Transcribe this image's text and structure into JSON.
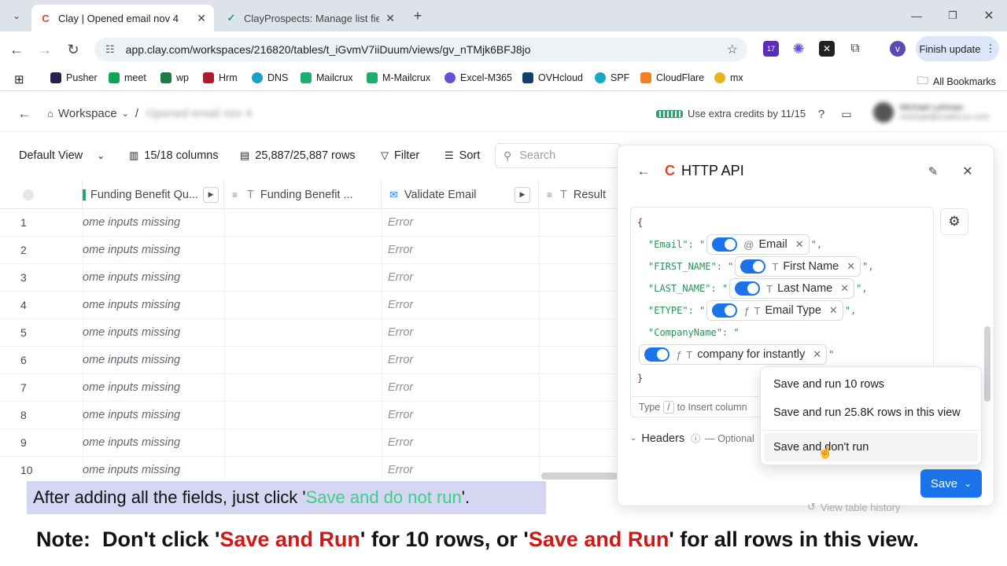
{
  "browser": {
    "tabs": [
      {
        "title": "Clay | Opened email nov 4",
        "active": true
      },
      {
        "title": "ClayProspects: Manage list field",
        "active": false
      }
    ],
    "url": "app.clay.com/workspaces/216820/tables/t_iGvmV7iiDuum/views/gv_nTMjk6BFJ8jo",
    "finish_update": "Finish update",
    "ext_badge": "17",
    "profile_initial": "v",
    "bookmarks": [
      "Pusher",
      "meet",
      "wp",
      "Hrm",
      "DNS",
      "Mailcrux",
      "M-Mailcrux",
      "Excel-M365",
      "OVHcloud",
      "SPF",
      "CloudFlare",
      "mx"
    ],
    "all_bookmarks": "All Bookmarks"
  },
  "app": {
    "breadcrumb_workspace": "Workspace",
    "breadcrumb_sep": "/",
    "table_name": "Opened email nov 4",
    "credits": "Use extra credits by 11/15",
    "user_name": "Michael Lehman",
    "user_email": "michael@mailcrux.com"
  },
  "toolbar": {
    "view": "Default View",
    "columns": "15/18 columns",
    "rows": "25,887/25,887 rows",
    "filter": "Filter",
    "sort": "Sort",
    "search_placeholder": "Search"
  },
  "grid": {
    "headers": [
      "Funding Benefit Qu...",
      "Funding Benefit ...",
      "Validate Email",
      "Result"
    ],
    "rows": [
      {
        "n": "1",
        "c1": "ome inputs missing",
        "c3": "Error"
      },
      {
        "n": "2",
        "c1": "ome inputs missing",
        "c3": "Error"
      },
      {
        "n": "3",
        "c1": "ome inputs missing",
        "c3": "Error"
      },
      {
        "n": "4",
        "c1": "ome inputs missing",
        "c3": "Error"
      },
      {
        "n": "5",
        "c1": "ome inputs missing",
        "c3": "Error"
      },
      {
        "n": "6",
        "c1": "ome inputs missing",
        "c3": "Error"
      },
      {
        "n": "7",
        "c1": "ome inputs missing",
        "c3": "Error"
      },
      {
        "n": "8",
        "c1": "ome inputs missing",
        "c3": "Error"
      },
      {
        "n": "9",
        "c1": "ome inputs missing",
        "c3": "Error"
      },
      {
        "n": "10",
        "c1": "ome inputs missing",
        "c3": "Error"
      }
    ]
  },
  "panel": {
    "title": "HTTP API",
    "open_brace": "{",
    "close_brace": "}",
    "fields": [
      {
        "key": "\"Email\": \"",
        "chip": "Email",
        "icon": "@",
        "fn": false,
        "tail": "\","
      },
      {
        "key": "\"FIRST_NAME\": \"",
        "chip": "First Name",
        "icon": "T",
        "fn": false,
        "tail": "\","
      },
      {
        "key": "\"LAST_NAME\": \"",
        "chip": "Last Name",
        "icon": "T",
        "fn": false,
        "tail": "\","
      },
      {
        "key": "\"ETYPE\": \"",
        "chip": "Email Type",
        "icon": "T",
        "fn": true,
        "tail": "\","
      },
      {
        "key": "\"CompanyName\": \"",
        "chip": "company for instantly",
        "icon": "T",
        "fn": true,
        "tail": "\""
      }
    ],
    "hint_type": "Type",
    "hint_key": "/",
    "hint_rest": "to Insert column",
    "headers_label": "Headers",
    "headers_optional": "— Optional",
    "view_history": "View table history"
  },
  "menu": {
    "items": [
      "Save and run 10 rows",
      "Save and run 25.8K rows in this view",
      "Save and don't run"
    ]
  },
  "save_button": "Save",
  "captions": {
    "line1_pre": "After adding all the fields, just click '",
    "line1_highlight": "Save and do not run",
    "line1_post": "'.",
    "line2_a": "Note:  Don't click '",
    "line2_b": "Save and Run",
    "line2_c": "' for 10 rows, or '",
    "line2_d": "Save and Run",
    "line2_e": "' for all rows in this view."
  }
}
